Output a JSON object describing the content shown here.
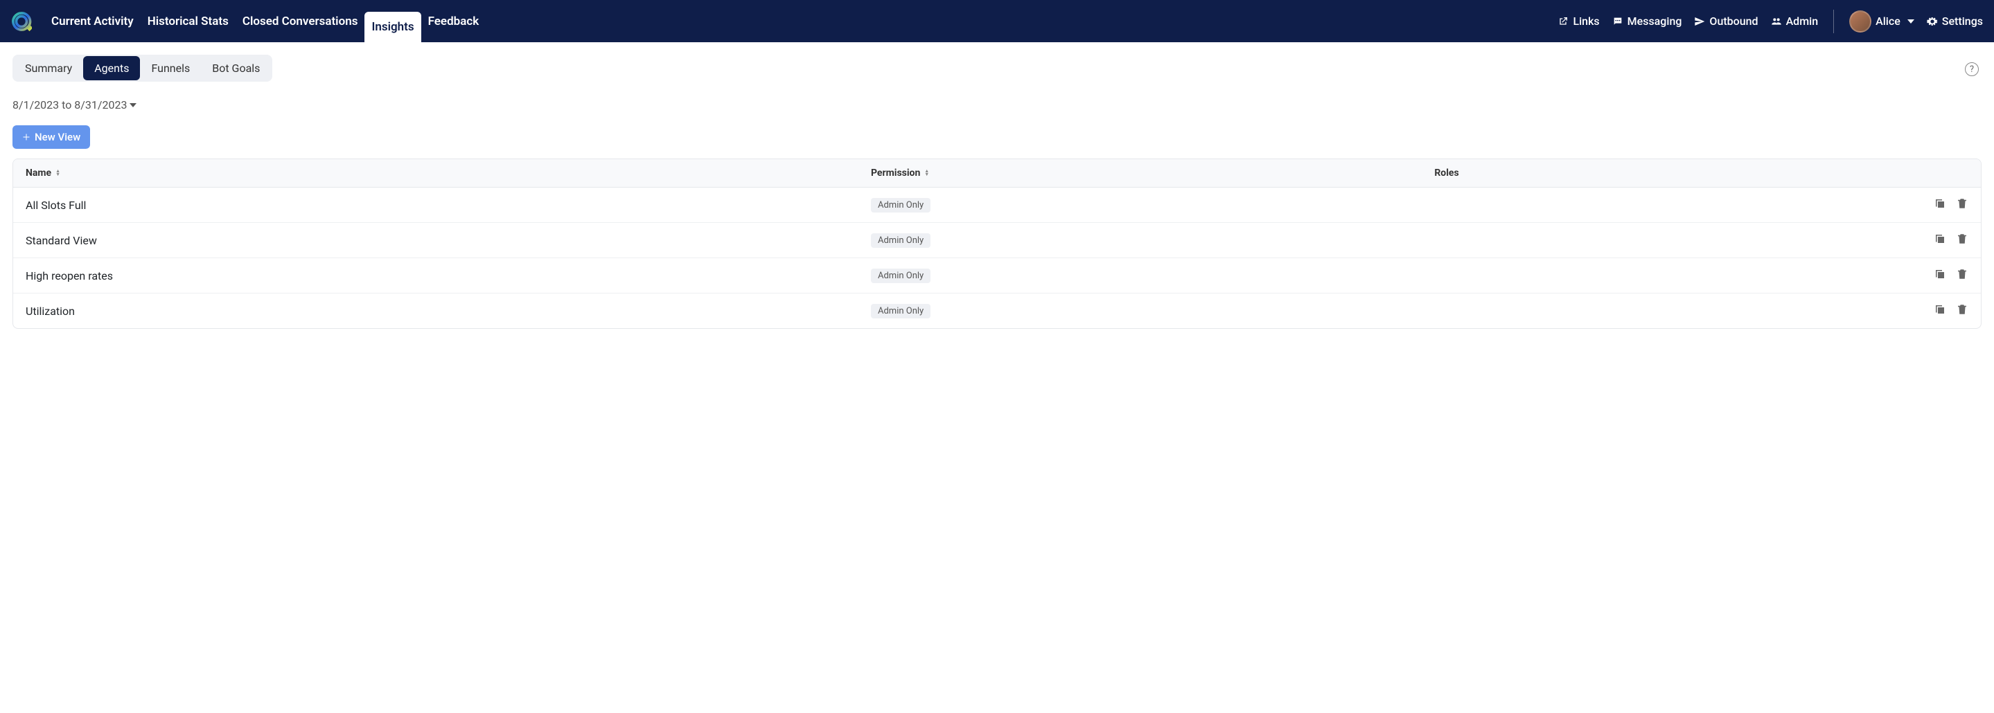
{
  "nav": {
    "tabs": [
      "Current Activity",
      "Historical Stats",
      "Closed Conversations",
      "Insights",
      "Feedback"
    ],
    "active_tab": "Insights",
    "right": {
      "links": "Links",
      "messaging": "Messaging",
      "outbound": "Outbound",
      "admin": "Admin",
      "user": "Alice",
      "settings": "Settings"
    }
  },
  "subtabs": {
    "items": [
      "Summary",
      "Agents",
      "Funnels",
      "Bot Goals"
    ],
    "active": "Agents"
  },
  "date_range": "8/1/2023 to 8/31/2023",
  "new_view_label": "New View",
  "table": {
    "columns": {
      "name": "Name",
      "permission": "Permission",
      "roles": "Roles"
    },
    "rows": [
      {
        "name": "All Slots Full",
        "permission": "Admin Only",
        "roles": ""
      },
      {
        "name": "Standard View",
        "permission": "Admin Only",
        "roles": ""
      },
      {
        "name": "High reopen rates",
        "permission": "Admin Only",
        "roles": ""
      },
      {
        "name": "Utilization",
        "permission": "Admin Only",
        "roles": ""
      }
    ]
  }
}
